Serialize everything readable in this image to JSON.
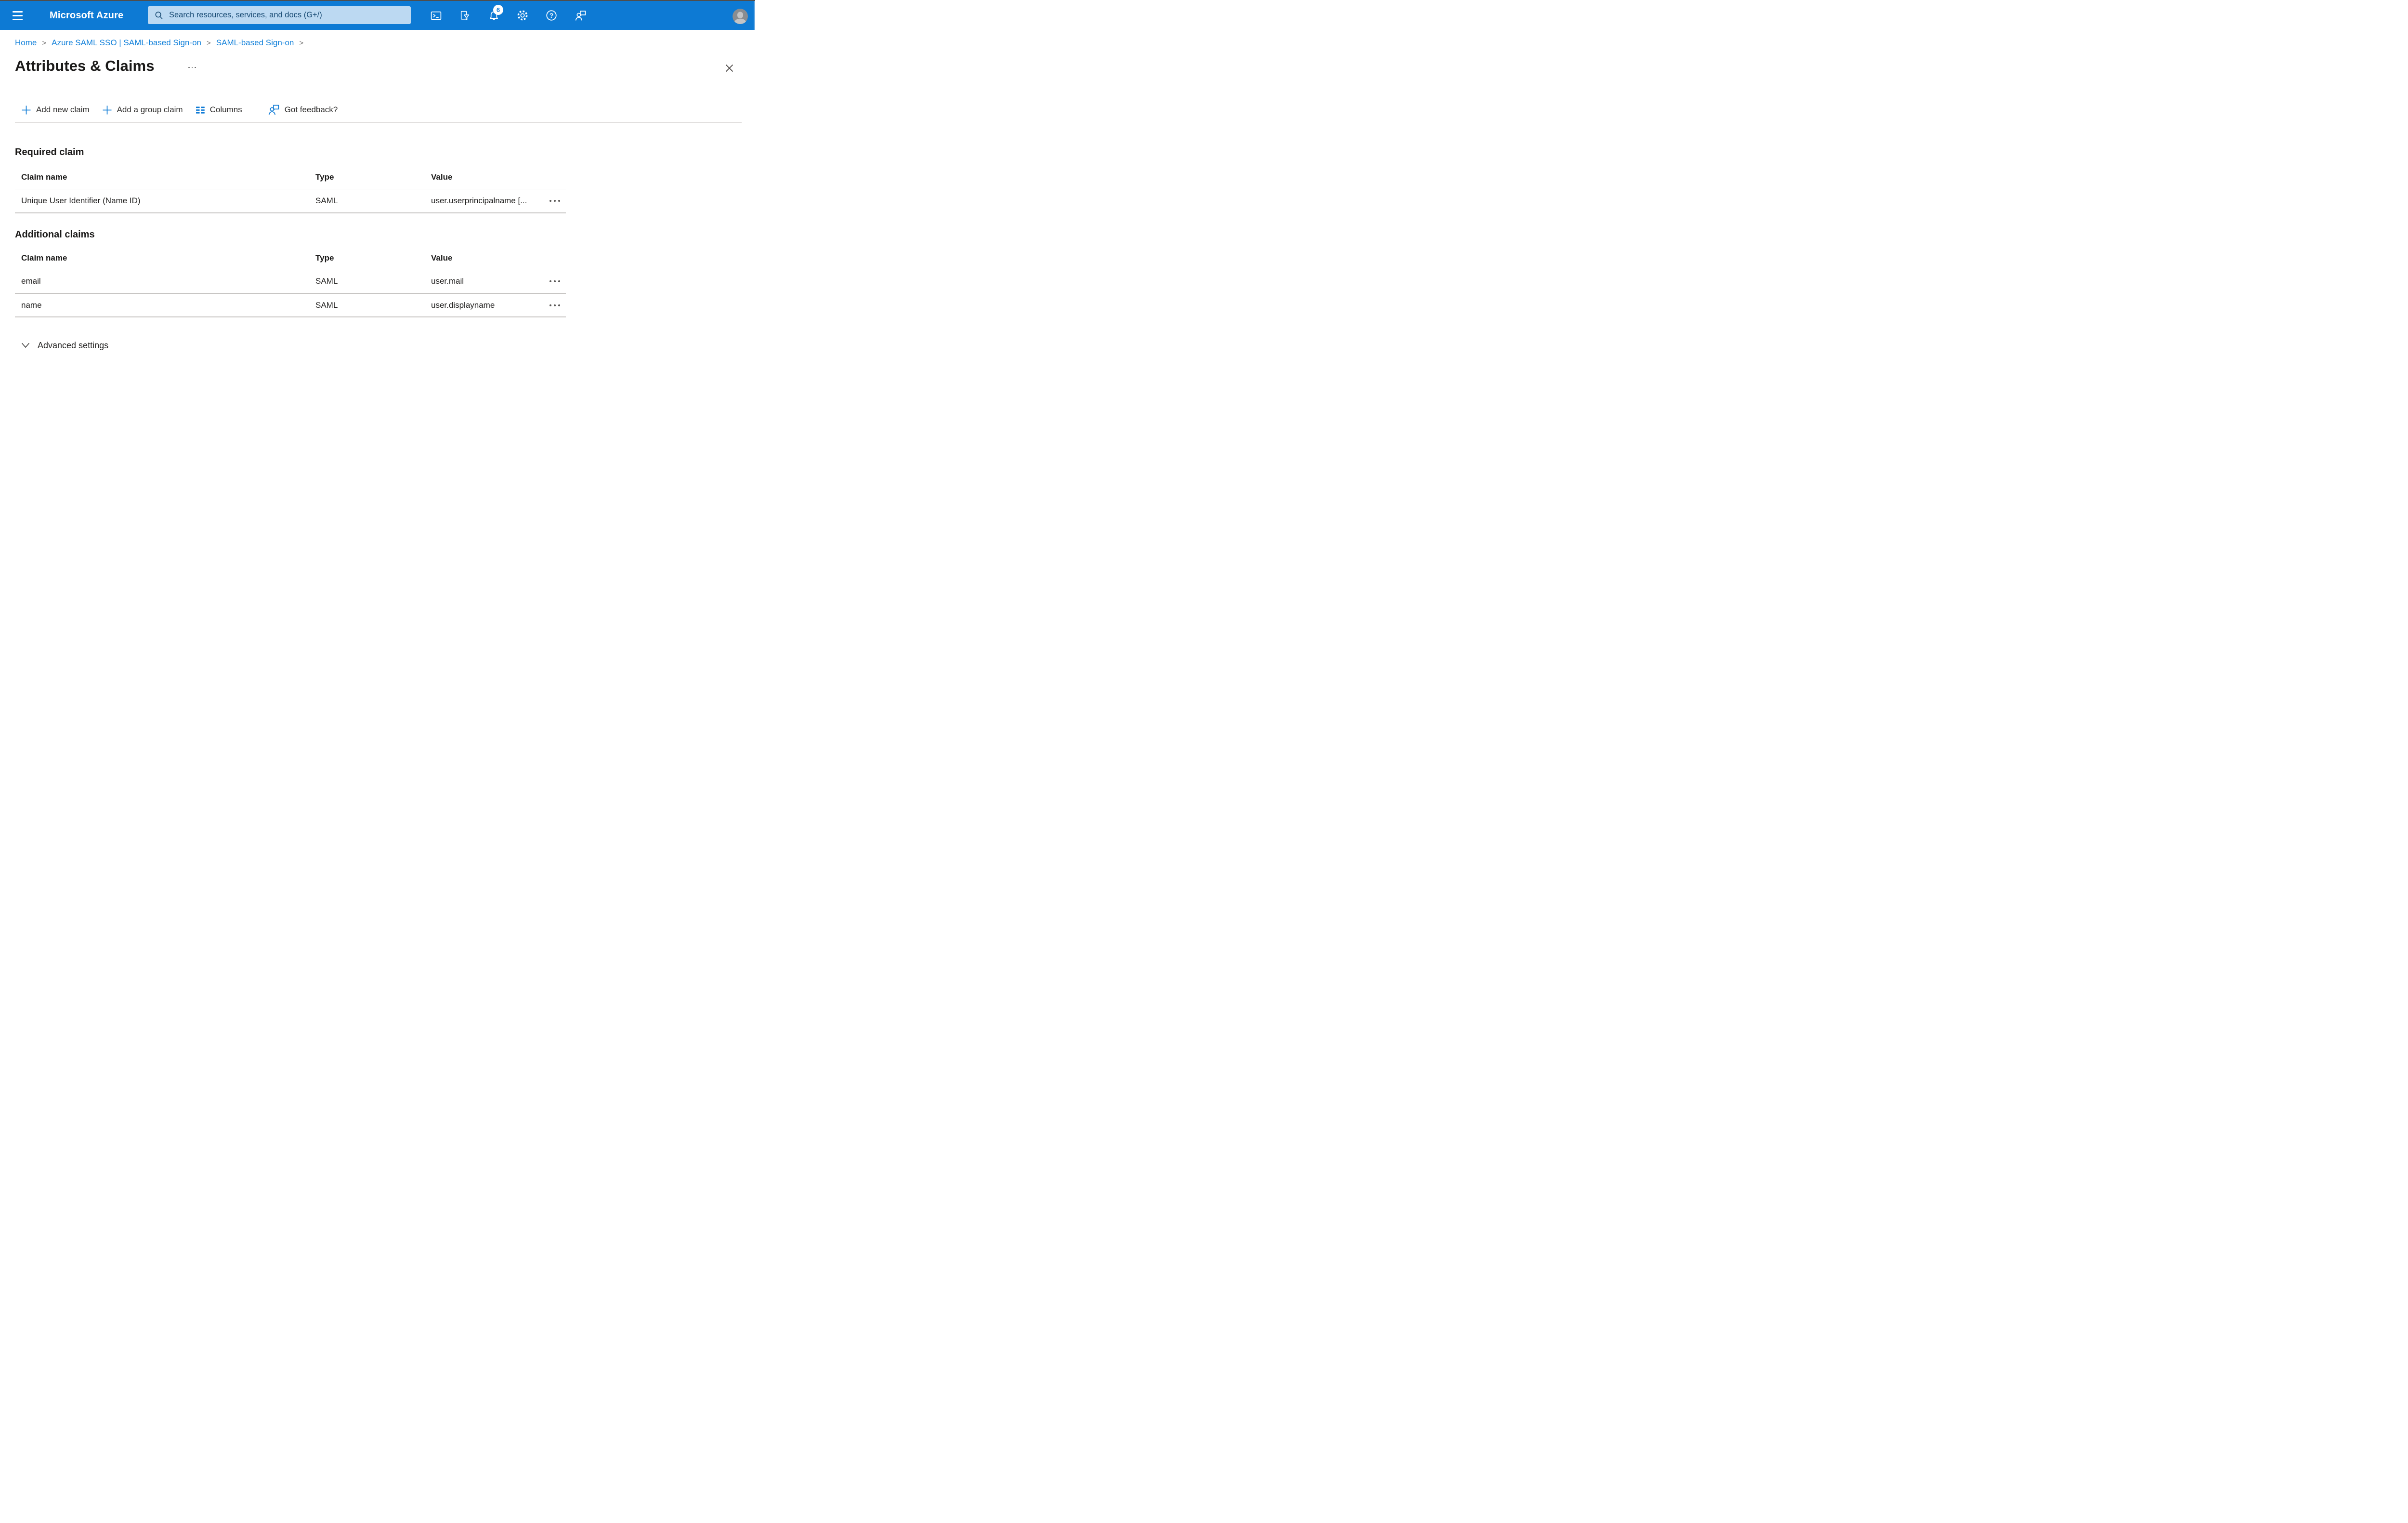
{
  "colors": {
    "topbar_blue": "#0d7ad4",
    "link_blue": "#1180da",
    "accent_blue": "#0f7bd6",
    "search_bg": "#bcd9f2",
    "search_text": "#174a73",
    "text_dark": "#1b1a19",
    "text_body": "#2f2e2d",
    "divider_light": "#e8e6e4",
    "divider_dark": "#c8c6c4"
  },
  "topbar": {
    "brand": "Microsoft Azure",
    "search_placeholder": "Search resources, services, and docs (G+/)",
    "notification_count": "6",
    "help_glyph": "?",
    "icons": [
      "hamburger-menu-icon",
      "search-icon",
      "cloud-shell-icon",
      "directory-filter-icon",
      "notifications-bell-icon",
      "settings-gear-icon",
      "help-icon",
      "feedback-icon",
      "user-avatar"
    ]
  },
  "breadcrumb": {
    "separator": ">",
    "items": [
      {
        "label": "Home"
      },
      {
        "label": "Azure SAML SSO | SAML-based Sign-on"
      },
      {
        "label": "SAML-based Sign-on"
      }
    ]
  },
  "page": {
    "title": "Attributes & Claims"
  },
  "toolbar": {
    "add_new_claim": "Add new claim",
    "add_group_claim": "Add a group claim",
    "columns": "Columns",
    "got_feedback": "Got feedback?"
  },
  "required_claim": {
    "heading": "Required claim",
    "columns": [
      "Claim name",
      "Type",
      "Value"
    ],
    "rows": [
      {
        "claim_name": "Unique User Identifier (Name ID)",
        "type": "SAML",
        "value": "user.userprincipalname [..."
      }
    ]
  },
  "additional_claims": {
    "heading": "Additional claims",
    "columns": [
      "Claim name",
      "Type",
      "Value"
    ],
    "rows": [
      {
        "claim_name": "email",
        "type": "SAML",
        "value": "user.mail"
      },
      {
        "claim_name": "name",
        "type": "SAML",
        "value": "user.displayname"
      }
    ]
  },
  "advanced_settings": {
    "label": "Advanced settings"
  }
}
